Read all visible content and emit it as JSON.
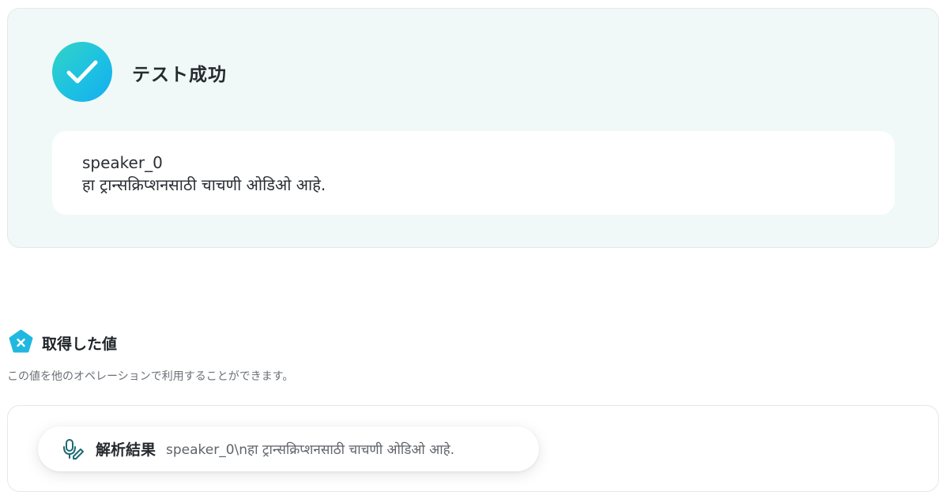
{
  "test_result": {
    "title": "テスト成功",
    "lines": [
      "speaker_0",
      "हा ट्रान्सक्रिप्शनसाठी चाचणी ओडिओ आहे."
    ]
  },
  "acquired_values": {
    "title": "取得した値",
    "description": "この値を他のオペレーションで利用することができます。",
    "items": [
      {
        "label": "解析結果",
        "value": "speaker_0\\nहा ट्रान्सक्रिप्शनसाठी चाचणी ओडिओ आहे.",
        "icon": "microphone-pen-icon"
      }
    ]
  },
  "colors": {
    "success_gradient_start": "#33d3c5",
    "success_gradient_end": "#14aef0",
    "panel_background": "#f1f9f8",
    "section_icon": "#1fb8e0"
  }
}
